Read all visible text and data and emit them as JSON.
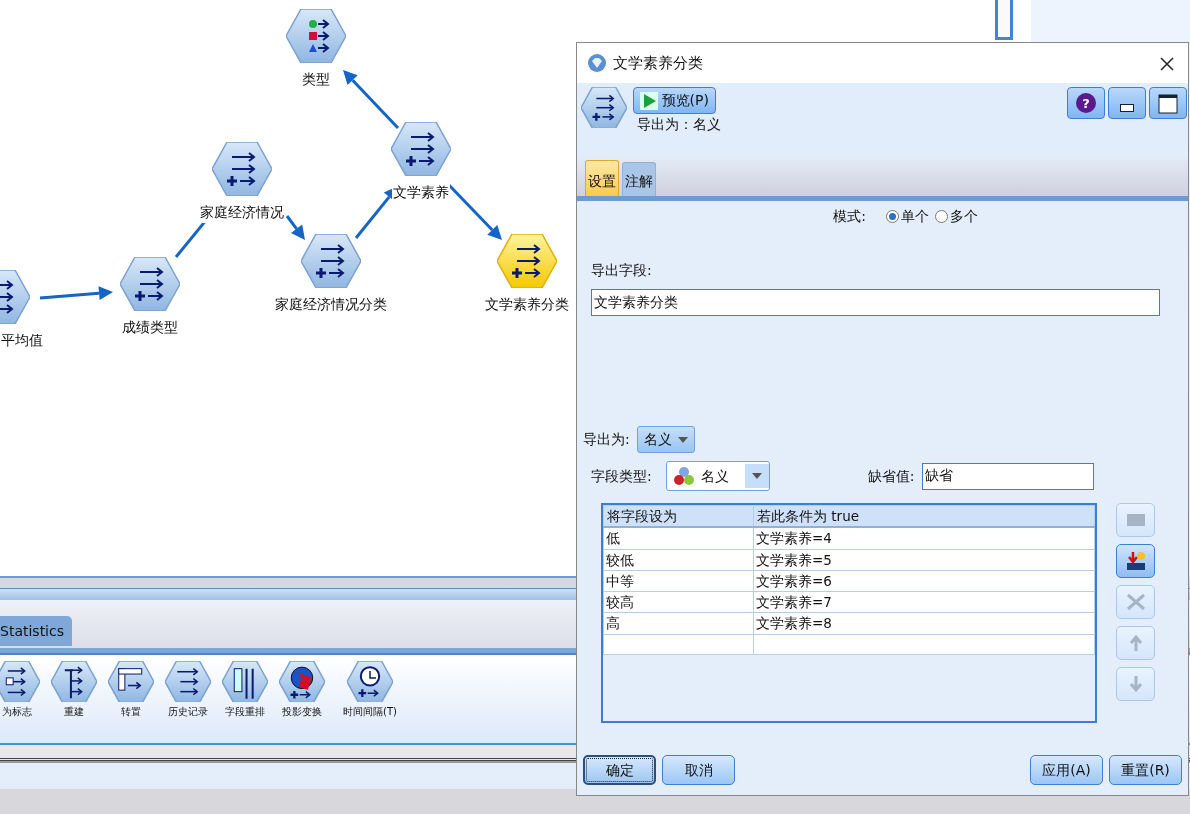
{
  "canvas": {
    "nodes": [
      {
        "label": "平均值",
        "kind": "derive",
        "selected": false
      },
      {
        "label": "成绩类型",
        "kind": "derive",
        "selected": false
      },
      {
        "label": "家庭经济情况",
        "kind": "derive",
        "selected": false
      },
      {
        "label": "家庭经济情况分类",
        "kind": "derive",
        "selected": false
      },
      {
        "label": "文学素养",
        "kind": "derive",
        "selected": false
      },
      {
        "label": "类型",
        "kind": "type",
        "selected": false
      },
      {
        "label": "文学素养分类",
        "kind": "derive",
        "selected": true
      }
    ]
  },
  "palette": {
    "tab": {
      "label": "Statistics"
    },
    "items": [
      {
        "label": "为标志",
        "kind": "flag"
      },
      {
        "label": "重建",
        "kind": "restructure"
      },
      {
        "label": "转置",
        "kind": "transpose"
      },
      {
        "label": "历史记录",
        "kind": "history"
      },
      {
        "label": "字段重排",
        "kind": "reorder"
      },
      {
        "label": "投影变换",
        "kind": "globe"
      },
      {
        "label": "时间间隔(T)",
        "kind": "clock"
      }
    ]
  },
  "dialog": {
    "title": "文学素养分类",
    "preview_button": "预览(P)",
    "summary": "导出为：名义",
    "tabs": [
      {
        "label": "设置",
        "selected": true
      },
      {
        "label": "注解",
        "selected": false
      }
    ],
    "mode": {
      "label": "模式:",
      "options": [
        {
          "label": "单个",
          "selected": true
        },
        {
          "label": "多个",
          "selected": false
        }
      ]
    },
    "derive_field": {
      "label": "导出字段:",
      "value": "文学素养分类"
    },
    "derive_as": {
      "label": "导出为:",
      "value": "名义"
    },
    "field_type": {
      "label": "字段类型:",
      "value": "名义"
    },
    "default_value": {
      "label": "缺省值:",
      "value": "缺省"
    },
    "table": {
      "columns": [
        "将字段设为",
        "若此条件为 true"
      ],
      "rows": [
        [
          "低",
          "文学素养=4"
        ],
        [
          "较低",
          "文学素养=5"
        ],
        [
          "中等",
          "文学素养=6"
        ],
        [
          "较高",
          "文学素养=7"
        ],
        [
          "高",
          "文学素养=8"
        ]
      ]
    },
    "side_buttons": [
      {
        "kind": "expression",
        "disabled": true
      },
      {
        "kind": "insert",
        "disabled": false
      },
      {
        "kind": "delete",
        "disabled": true
      },
      {
        "kind": "up",
        "disabled": true
      },
      {
        "kind": "down",
        "disabled": true
      }
    ],
    "help_button": "?",
    "left_buttons": [
      {
        "label": "确定",
        "focused": true
      },
      {
        "label": "取消",
        "focused": false
      }
    ],
    "right_buttons": [
      {
        "label": "应用(A)",
        "focused": false
      },
      {
        "label": "重置(R)",
        "focused": false
      }
    ]
  }
}
